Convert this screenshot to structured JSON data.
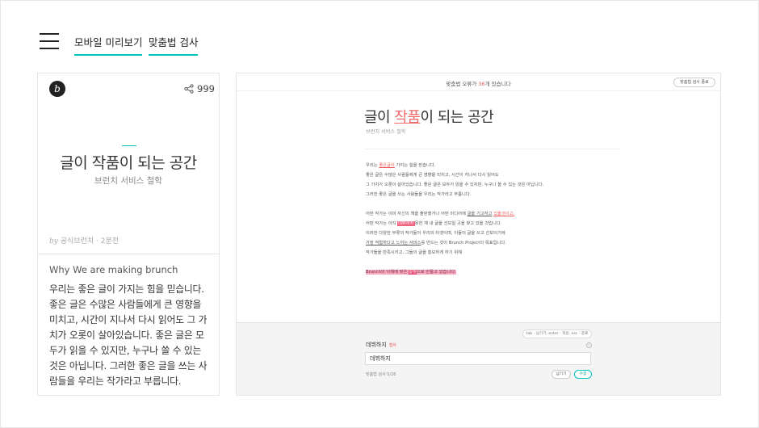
{
  "nav": {
    "tabs": [
      {
        "label": "모바일 미리보기"
      },
      {
        "label": "맞춤법 검사"
      }
    ],
    "accent_color": "#00c3bd"
  },
  "mobile_preview": {
    "logo_letter": "b",
    "share_count": "999",
    "title": "글이 작품이 되는 공간",
    "subtitle": "브런치 서비스 철학",
    "byline_prefix": "by",
    "byline": "공식브런치 · 2분전",
    "body_heading": "Why We are making brunch",
    "body_text": "우리는 좋은 글이 가지는 힘을 믿습니다. 좋은 글은 수많은 사람들에게 큰 영향을 미치고, 시간이 지나서 다시 읽어도 그 가치가 오롯이 살아있습니다. 좋은 글은 모두가 읽을 수 있지만, 누구나 쓸 수 있는 것은 아닙니다. 그러한 좋은 글을 쓰는 사람들을 우리는 작가라고 부릅니다."
  },
  "spell_editor": {
    "status_prefix": "맞춤법 오류가 ",
    "status_count": "36",
    "status_suffix": "개 있습니다",
    "close_button": "맞춤법 검사 종료",
    "title_pre": "글이 ",
    "title_err": "작품",
    "title_post": "이 되는 공간",
    "subtitle": "브런치 서비스 철학",
    "p1": {
      "l1_pre": "우리는 ",
      "l1_err": "좋은글이",
      "l1_post": " 가지는 힘을 믿습니다.",
      "l2": "좋은 글은 수많은 사람들에게 큰 영향을 미치고, 시간이 지나서 다시 읽어도",
      "l3": "그 가치가 오롯이 살아있습니다. 좋은 글은 모두가 읽을 수 있지만, 누구나 쓸 수 있는 것은 아닙니다.",
      "l4": "그러한 좋은 글을 쓰는 사람들을 우리는 작가라고 부릅니다."
    },
    "p2": {
      "l1_pre": "어떤 작가는 이미 자신의 책을 출판했거나 어떤 미디어에 ",
      "l1_u1": "글을 기고하고",
      "l1_sp": " ",
      "l1_err": "있을것이고,",
      "l2_pre": "어떤 작가는 아직 ",
      "l2_hl": "데뷔하지",
      "l2_post": "못한 채 내 글을 선보일 곳을 찾고 있을 것입니다.",
      "l3": "이러한 다양한 부류의 작가들이 우리의 타겟이며, 이들이 글을 쓰고 선보이기에",
      "l4_u": "가장 적합하다고 느끼는 서비스",
      "l4_post": "를 만드는 것이 Brunch Project의 목표입니다.",
      "l5": "작가들을 반족시키고, 그들의 글을 홍보하게 하기 위해"
    },
    "p3": {
      "pre": "Brunch의 이해에 맞은 ",
      "err": "설정",
      "post": "으로 만들고 있습니다."
    }
  },
  "spell_panel": {
    "hint": "tab - 넘기기, enter - 적용, esc - 종료",
    "current_word": "데뷔하지",
    "tag": "철자",
    "info_icon": "i",
    "suggestion_value": "데뷔하지",
    "progress": "맞춤법 검사 5/26",
    "skip_button": "넘기기",
    "fix_button": "수정",
    "error_color": "#ef5a5a",
    "highlight_color": "#ef5f7e"
  }
}
